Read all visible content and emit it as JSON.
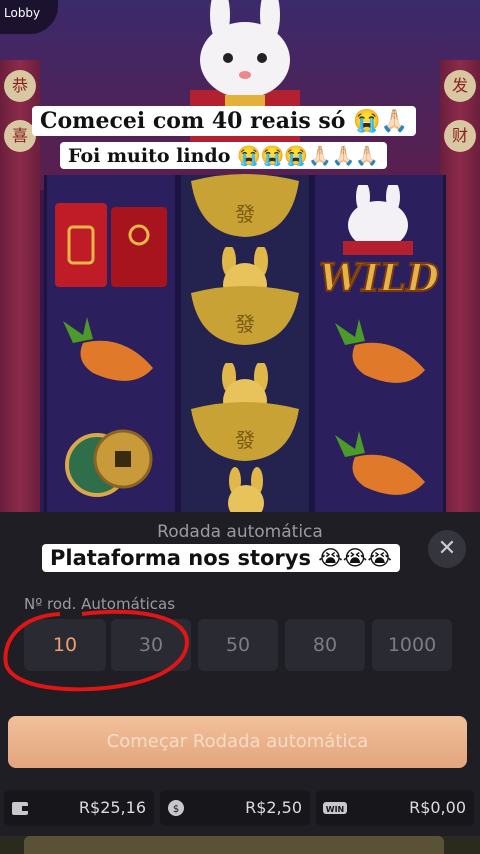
{
  "lobby": {
    "label": "Lobby"
  },
  "captions": {
    "line1": "Comecei com 40 reais só 😭🙏🏻",
    "line2": "Foi muito lindo 😭😭😭🙏🏻🙏🏻🙏🏻",
    "line3": "Plataforma nos storys 😭😭😭"
  },
  "reels": {
    "wild_label": "WILD",
    "ingot_char": "發"
  },
  "pillar_chars": {
    "left": [
      "恭",
      "喜"
    ],
    "right": [
      "发",
      "财"
    ]
  },
  "auto_panel": {
    "title": "Rodada automática",
    "spins_label": "Nº rod. Automáticas",
    "options": [
      "10",
      "30",
      "50",
      "80",
      "1000"
    ],
    "selected": "10",
    "start_label": "Começar Rodada automática",
    "close_icon": "close-icon"
  },
  "stats": {
    "balance": "R$25,16",
    "bet": "R$2,50",
    "win": "R$0,00"
  },
  "colors": {
    "accent": "#e3a57e",
    "selected_text": "#e8a070",
    "annotation_circle": "#e01515"
  }
}
